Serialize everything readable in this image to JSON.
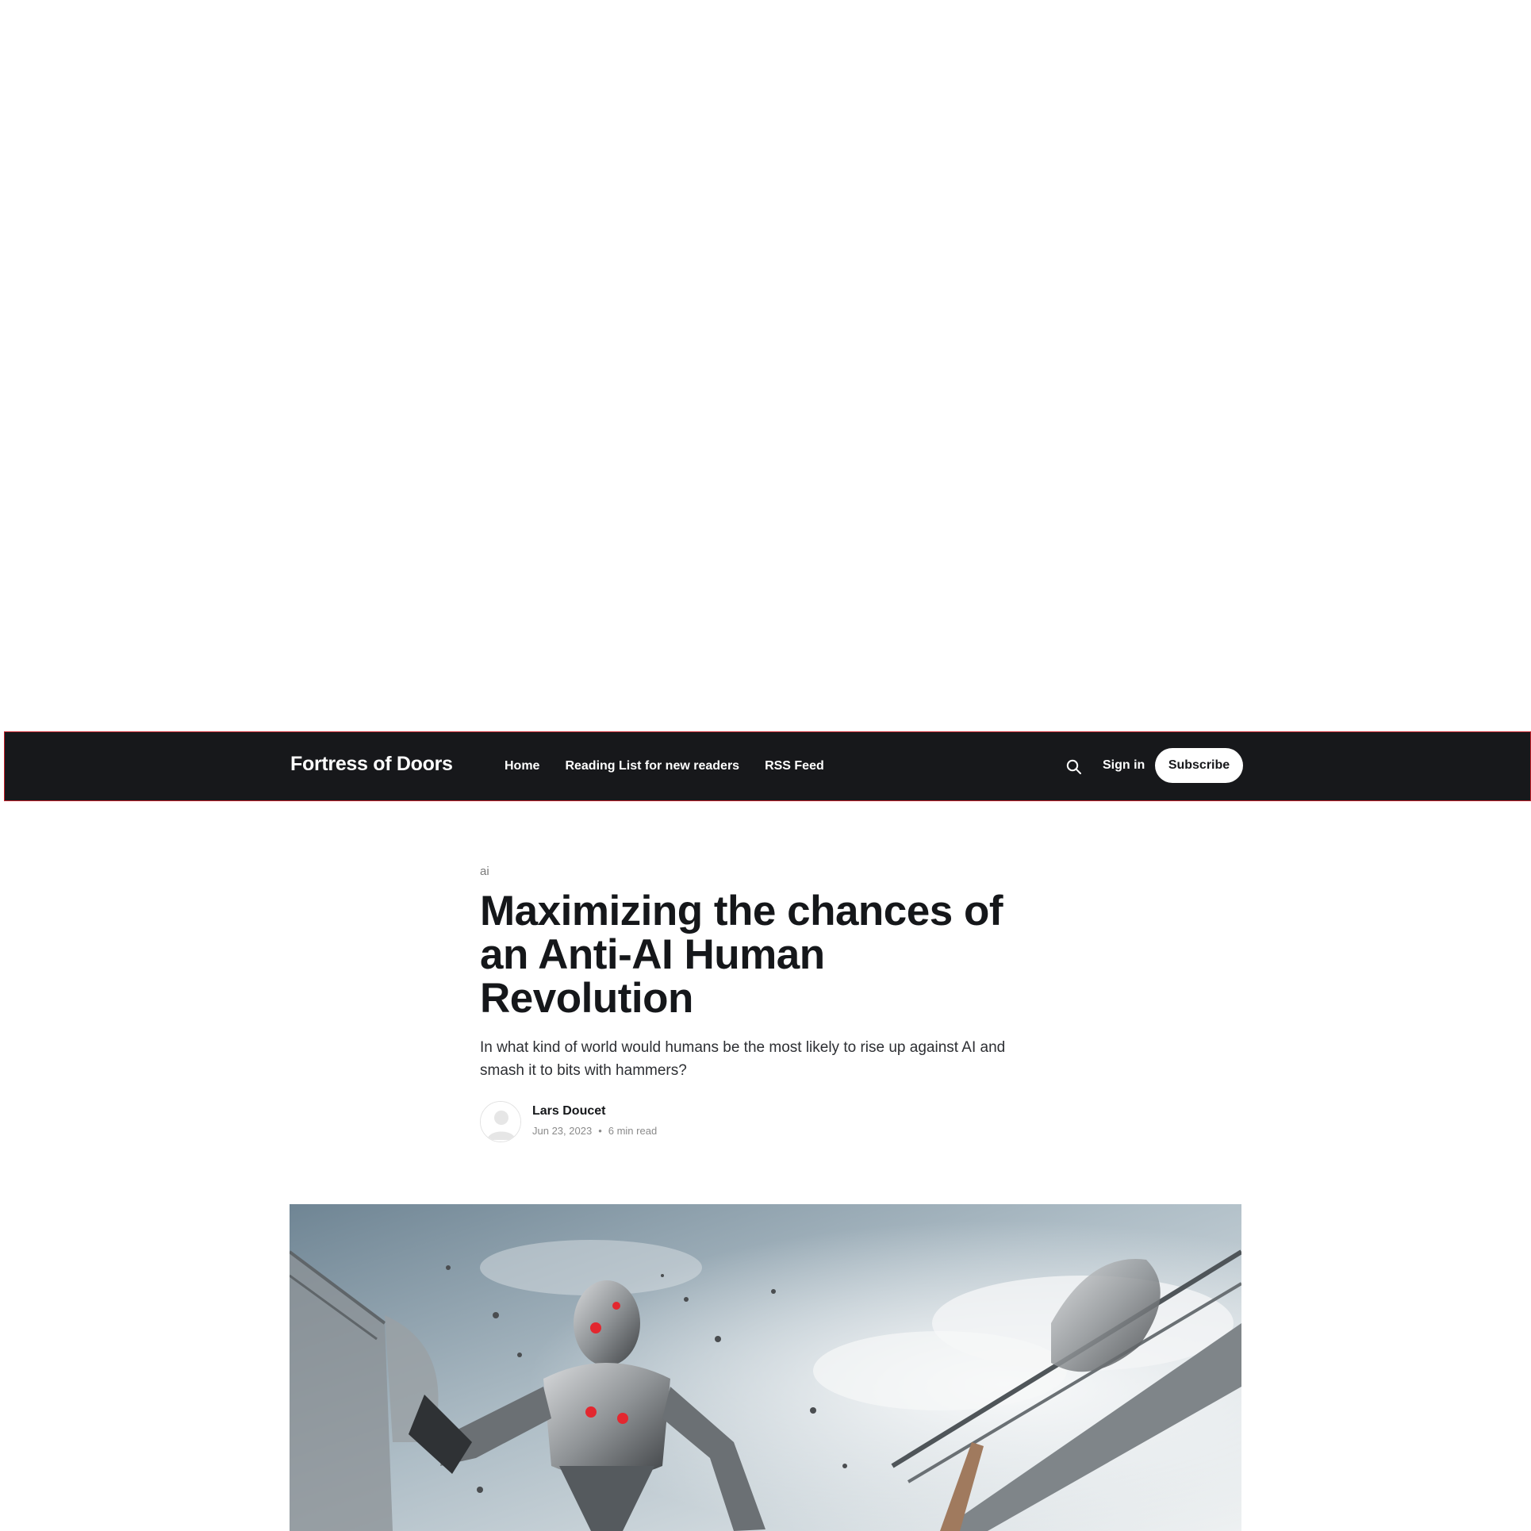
{
  "header": {
    "site_title": "Fortress of Doors",
    "nav": [
      {
        "label": "Home"
      },
      {
        "label": "Reading List for new readers"
      },
      {
        "label": "RSS Feed"
      }
    ],
    "search_icon": "search-icon",
    "signin_label": "Sign in",
    "subscribe_label": "Subscribe"
  },
  "article": {
    "tag": "ai",
    "title": "Maximizing the chances of an Anti-AI Human Revolution",
    "excerpt": "In what kind of world would humans be the most likely to rise up against AI and smash it to bits with hammers?",
    "author": "Lars Doucet",
    "date": "Jun 23, 2023",
    "separator": "•",
    "read_time": "6 min read"
  },
  "colors": {
    "header_bg": "#17181b",
    "header_border": "#c4202a",
    "text_dark": "#15171a",
    "muted": "#8a8a8a"
  }
}
